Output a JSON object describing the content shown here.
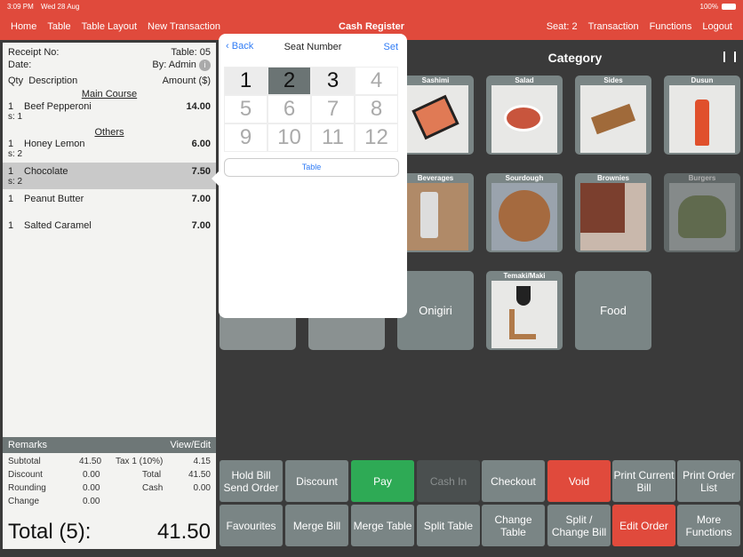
{
  "status": {
    "time": "3:09 PM",
    "date": "Wed 28 Aug",
    "battery": "100%"
  },
  "nav": {
    "left": [
      "Home",
      "Table",
      "Table Layout",
      "New Transaction"
    ],
    "title": "Cash Register",
    "right": [
      "Seat: 2",
      "Transaction",
      "Functions",
      "Logout"
    ]
  },
  "receipt": {
    "receipt_no_label": "Receipt No:",
    "table": "Table: 05",
    "date_label": "Date:",
    "by": "By: Admin",
    "qty_header": "Qty",
    "desc_header": "Description",
    "amount_header": "Amount ($)",
    "sections": [
      "Main Course",
      "Others"
    ],
    "items": [
      {
        "qty": "1",
        "name": "Beef Pepperoni",
        "amount": "14.00",
        "seat": "s: 1"
      },
      {
        "qty": "1",
        "name": "Honey Lemon",
        "amount": "6.00",
        "seat": "s: 2"
      },
      {
        "qty": "1",
        "name": "Chocolate",
        "amount": "7.50",
        "seat": "s: 2"
      },
      {
        "qty": "1",
        "name": "Peanut Butter",
        "amount": "7.00",
        "seat": ""
      },
      {
        "qty": "1",
        "name": "Salted Caramel",
        "amount": "7.00",
        "seat": ""
      }
    ],
    "remarks": "Remarks",
    "view_edit": "View/Edit",
    "totals": {
      "subtotal_l": "Subtotal",
      "subtotal": "41.50",
      "discount_l": "Discount",
      "discount": "0.00",
      "rounding_l": "Rounding",
      "rounding": "0.00",
      "change_l": "Change",
      "change": "0.00",
      "tax_l": "Tax 1 (10%)",
      "tax": "4.15",
      "total_l": "Total",
      "total": "41.50",
      "cash_l": "Cash",
      "cash": "0.00"
    },
    "grand_label": "Total (5):",
    "grand": "41.50"
  },
  "popover": {
    "back": "Back",
    "title": "Seat Number",
    "set": "Set",
    "keys": [
      "1",
      "2",
      "3",
      "4",
      "5",
      "6",
      "7",
      "8",
      "9",
      "10",
      "11",
      "12"
    ],
    "selected": "2",
    "table": "Table"
  },
  "category": {
    "title": "Category",
    "tiles": [
      "Sashimi",
      "Salad",
      "Sides",
      "Dusun",
      "Beverages",
      "Sourdough",
      "Brownies",
      "Burgers",
      "Onigiri",
      "Temaki/Maki",
      "Food"
    ]
  },
  "buttons": [
    [
      "Hold Bill Send Order",
      "Discount",
      "Pay",
      "Cash In",
      "Checkout",
      "Void",
      "Print Current Bill",
      "Print Order List"
    ],
    [
      "Favourites",
      "Merge Bill",
      "Merge Table",
      "Split Table",
      "Change Table",
      "Split / Change Bill",
      "Edit Order",
      "More Functions"
    ]
  ],
  "colors": {
    "brand": "#e04a3c",
    "pay": "#2eaa55",
    "void": "#e04a3c",
    "tile": "#7a8585"
  }
}
